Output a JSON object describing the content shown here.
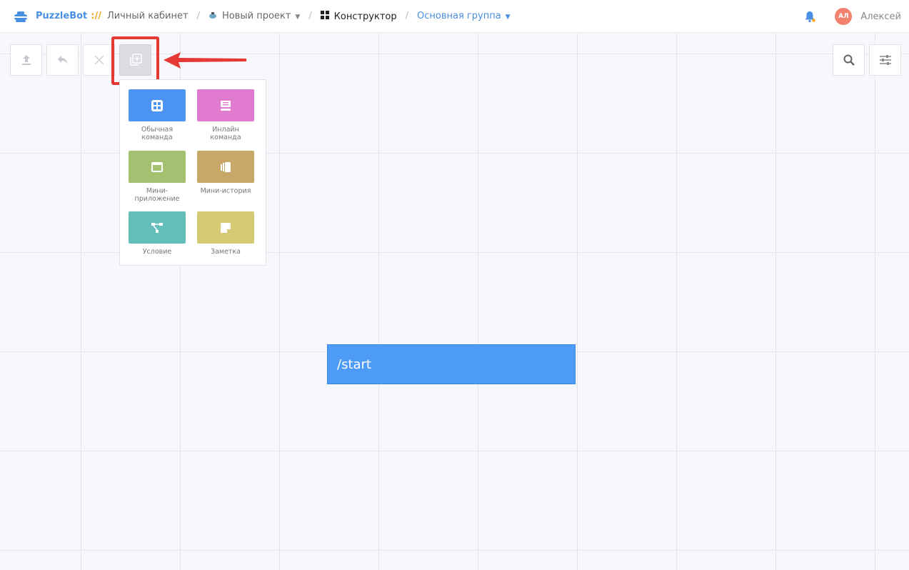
{
  "header": {
    "brand": "PuzzleBot",
    "brand_separator": "://",
    "crumbs": {
      "cabinet": "Личный кабинет",
      "project": "Новый проект",
      "constructor": "Конструктор",
      "group": "Основная группа"
    },
    "user": {
      "initials": "АЛ",
      "name": "Алексей"
    }
  },
  "toolbar": {
    "left": [
      "upload-icon",
      "undo-icon",
      "close-icon",
      "add-block-icon"
    ],
    "right": [
      "search-icon",
      "settings-sliders-icon"
    ]
  },
  "add_menu": {
    "items": [
      {
        "label": "Обычная команда",
        "color": "#4d95f5",
        "icon": "grid-icon"
      },
      {
        "label": "Инлайн команда",
        "color": "#e07bd0",
        "icon": "inline-list-icon"
      },
      {
        "label": "Мини-приложение",
        "color": "#a3c170",
        "icon": "window-icon"
      },
      {
        "label": "Мини-история",
        "color": "#c8a76a",
        "icon": "cards-icon"
      },
      {
        "label": "Условие",
        "color": "#63bdb9",
        "icon": "branch-icon"
      },
      {
        "label": "Заметка",
        "color": "#d5c974",
        "icon": "note-icon"
      }
    ]
  },
  "canvas": {
    "start_node_label": "/start",
    "start_node_color": "#4d9af7"
  },
  "colors": {
    "accent": "#4a90e2",
    "highlight": "#e53935"
  }
}
